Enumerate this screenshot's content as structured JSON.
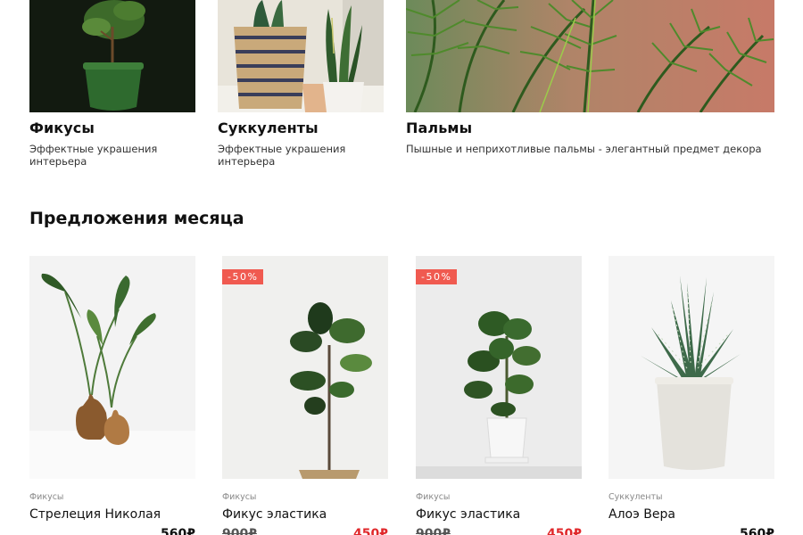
{
  "categories": [
    {
      "title": "Фикусы",
      "desc": "Эффектные украшения интерьера"
    },
    {
      "title": "Суккуленты",
      "desc": "Эффектные украшения интерьера"
    },
    {
      "title": "Пальмы",
      "desc": "Пышные и неприхотливые пальмы - элегантный предмет декора"
    }
  ],
  "offers": {
    "title": "Предложения месяца",
    "products": [
      {
        "category": "Фикусы",
        "name": "Стрелеция Николая",
        "old_price": "",
        "price": "560₽",
        "badge": ""
      },
      {
        "category": "Фикусы",
        "name": "Фикус эластика",
        "old_price": "900₽",
        "price": "450₽",
        "badge": "-50%"
      },
      {
        "category": "Фикусы",
        "name": "Фикус эластика",
        "old_price": "900₽",
        "price": "450₽",
        "badge": "-50%"
      },
      {
        "category": "Суккуленты",
        "name": "Алоэ Вера",
        "old_price": "",
        "price": "560₽",
        "badge": ""
      }
    ]
  },
  "colors": {
    "sale": "#e0282b",
    "badge": "#f05a50"
  }
}
